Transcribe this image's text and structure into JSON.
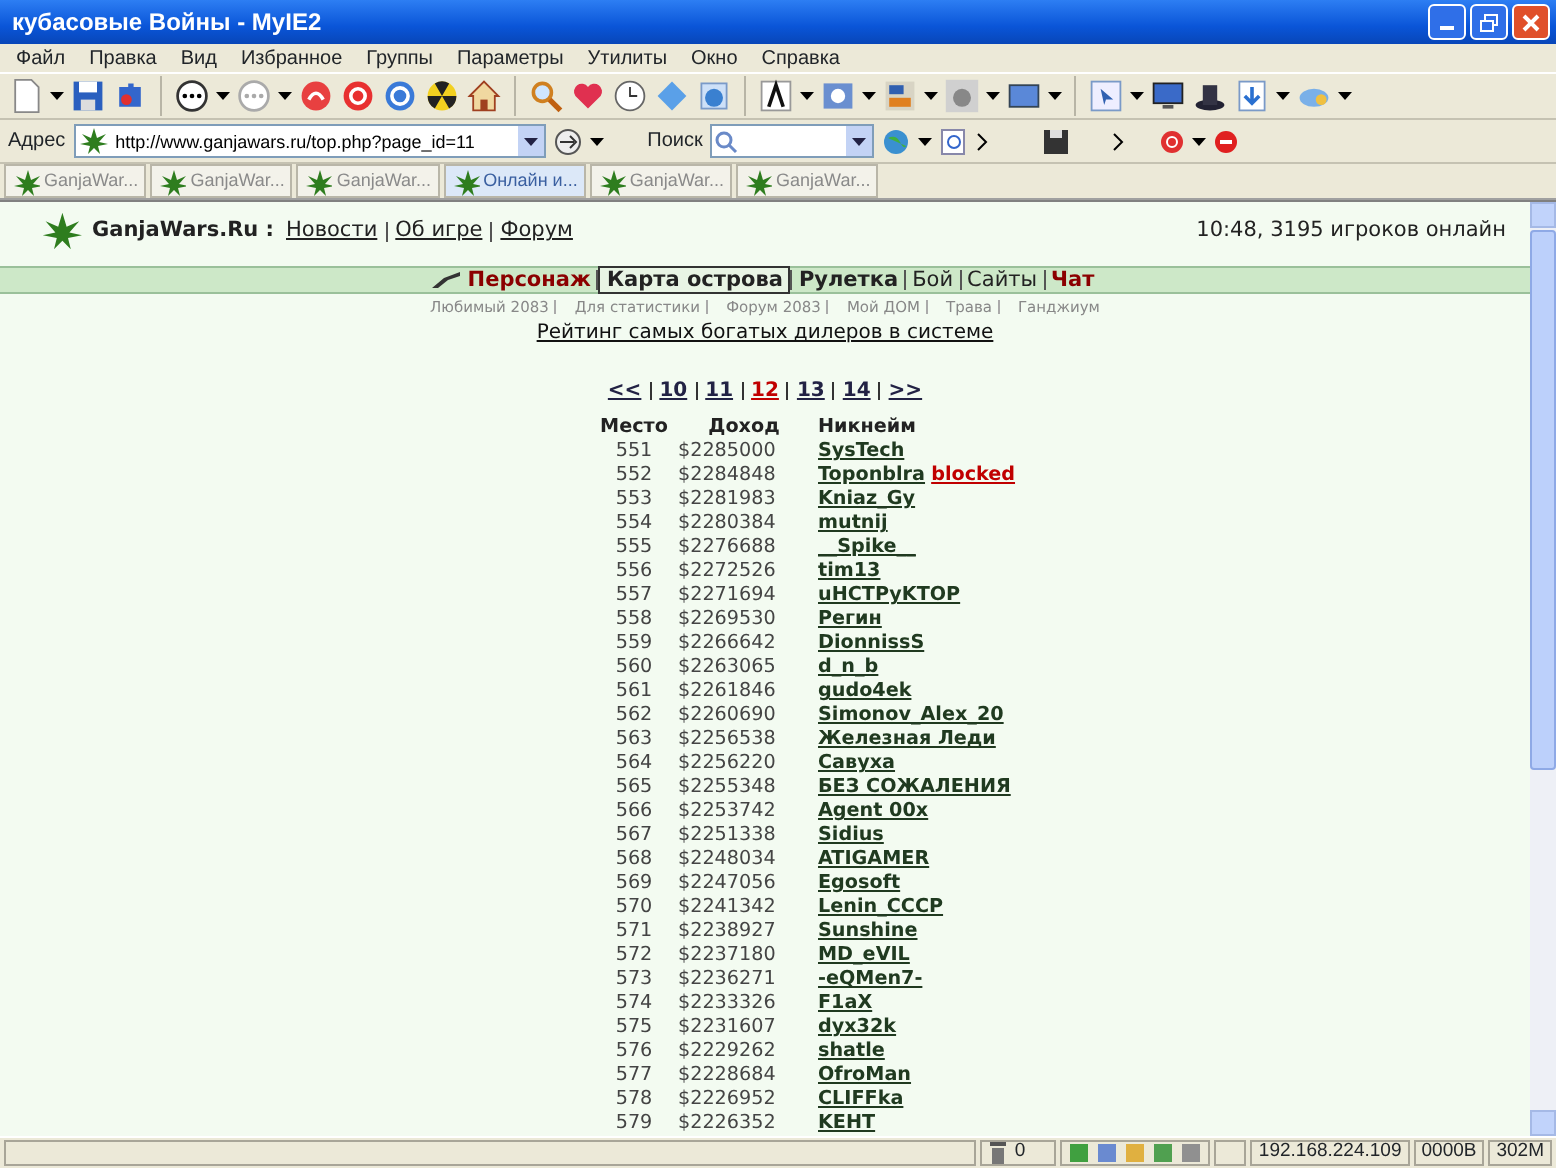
{
  "window": {
    "title": "кубасовые Войны - MyIE2"
  },
  "menu": [
    "Файл",
    "Правка",
    "Вид",
    "Избранное",
    "Группы",
    "Параметры",
    "Утилиты",
    "Окно",
    "Справка"
  ],
  "address_bar": {
    "label": "Адрес",
    "url": "http://www.ganjawars.ru/top.php?page_id=11"
  },
  "search": {
    "label": "Поиск"
  },
  "tabs": [
    {
      "label": "GanjaWar...",
      "selected": false
    },
    {
      "label": "GanjaWar...",
      "selected": false
    },
    {
      "label": "GanjaWar...",
      "selected": false
    },
    {
      "label": "Онлайн и...",
      "selected": true
    },
    {
      "label": "GanjaWar...",
      "selected": false
    },
    {
      "label": "GanjaWar...",
      "selected": false
    }
  ],
  "page": {
    "site_name": "GanjaWars.Ru :",
    "header_links": [
      "Новости",
      "Об игре",
      "Форум"
    ],
    "online": "10:48, 3195 игроков онлайн",
    "nav": [
      {
        "label": "Персонаж",
        "kind": "alert",
        "selected": false
      },
      {
        "label": "Карта острова",
        "kind": "bold",
        "selected": true
      },
      {
        "label": "Рулетка",
        "kind": "bold",
        "selected": false
      },
      {
        "label": "Бой",
        "kind": "plain",
        "selected": false
      },
      {
        "label": "Сайты",
        "kind": "plain",
        "selected": false
      },
      {
        "label": "Чат",
        "kind": "alert",
        "selected": false
      }
    ],
    "sub_links": [
      "Любимый 2083",
      "Для статистики",
      "Форум 2083",
      "Мой ДОМ",
      "Трава",
      "Ганджиум"
    ],
    "heading": "Рейтинг самых богатых дилеров в системе",
    "pagination": [
      {
        "label": "<<",
        "selected": false
      },
      {
        "label": "10",
        "selected": false
      },
      {
        "label": "11",
        "selected": false
      },
      {
        "label": "12",
        "selected": true
      },
      {
        "label": "13",
        "selected": false
      },
      {
        "label": "14",
        "selected": false
      },
      {
        "label": ">>",
        "selected": false
      }
    ],
    "table": {
      "columns": [
        "Место",
        "Доход",
        "Никнейм"
      ],
      "rows": [
        {
          "place": "551",
          "income": "$2285000",
          "nickname": "SysTech"
        },
        {
          "place": "552",
          "income": "$2284848",
          "nickname": "Toponblra",
          "tag": "blocked"
        },
        {
          "place": "553",
          "income": "$2281983",
          "nickname": "Kniaz_Gy"
        },
        {
          "place": "554",
          "income": "$2280384",
          "nickname": "mutnij"
        },
        {
          "place": "555",
          "income": "$2276688",
          "nickname": "__Spike__"
        },
        {
          "place": "556",
          "income": "$2272526",
          "nickname": "tim13"
        },
        {
          "place": "557",
          "income": "$2271694",
          "nickname": "uHCTPyKTOP"
        },
        {
          "place": "558",
          "income": "$2269530",
          "nickname": "Регин"
        },
        {
          "place": "559",
          "income": "$2266642",
          "nickname": "DionnissS"
        },
        {
          "place": "560",
          "income": "$2263065",
          "nickname": "d_n_b"
        },
        {
          "place": "561",
          "income": "$2261846",
          "nickname": "gudo4ek"
        },
        {
          "place": "562",
          "income": "$2260690",
          "nickname": "Simonov_Alex_20"
        },
        {
          "place": "563",
          "income": "$2256538",
          "nickname": "Железная Леди"
        },
        {
          "place": "564",
          "income": "$2256220",
          "nickname": "Савуха"
        },
        {
          "place": "565",
          "income": "$2255348",
          "nickname": "БЕЗ СОЖАЛЕНИЯ"
        },
        {
          "place": "566",
          "income": "$2253742",
          "nickname": "Agent 00x"
        },
        {
          "place": "567",
          "income": "$2251338",
          "nickname": "Sidius"
        },
        {
          "place": "568",
          "income": "$2248034",
          "nickname": "ATIGAMER"
        },
        {
          "place": "569",
          "income": "$2247056",
          "nickname": "Egosoft"
        },
        {
          "place": "570",
          "income": "$2241342",
          "nickname": "Lenin_CCCP"
        },
        {
          "place": "571",
          "income": "$2238927",
          "nickname": "Sunshine"
        },
        {
          "place": "572",
          "income": "$2237180",
          "nickname": "MD_eVIL"
        },
        {
          "place": "573",
          "income": "$2236271",
          "nickname": "-eQMen7-"
        },
        {
          "place": "574",
          "income": "$2233326",
          "nickname": "F1aX"
        },
        {
          "place": "575",
          "income": "$2231607",
          "nickname": "dyx32k"
        },
        {
          "place": "576",
          "income": "$2229262",
          "nickname": "shatle"
        },
        {
          "place": "577",
          "income": "$2228684",
          "nickname": "OfroMan"
        },
        {
          "place": "578",
          "income": "$2226952",
          "nickname": "CLIFFka"
        },
        {
          "place": "579",
          "income": "$2226352",
          "nickname": "KEHT"
        }
      ]
    }
  },
  "status_bar": {
    "trash_count": "0",
    "ip": "192.168.224.109",
    "traffic": "0000B",
    "memory": "302M"
  }
}
